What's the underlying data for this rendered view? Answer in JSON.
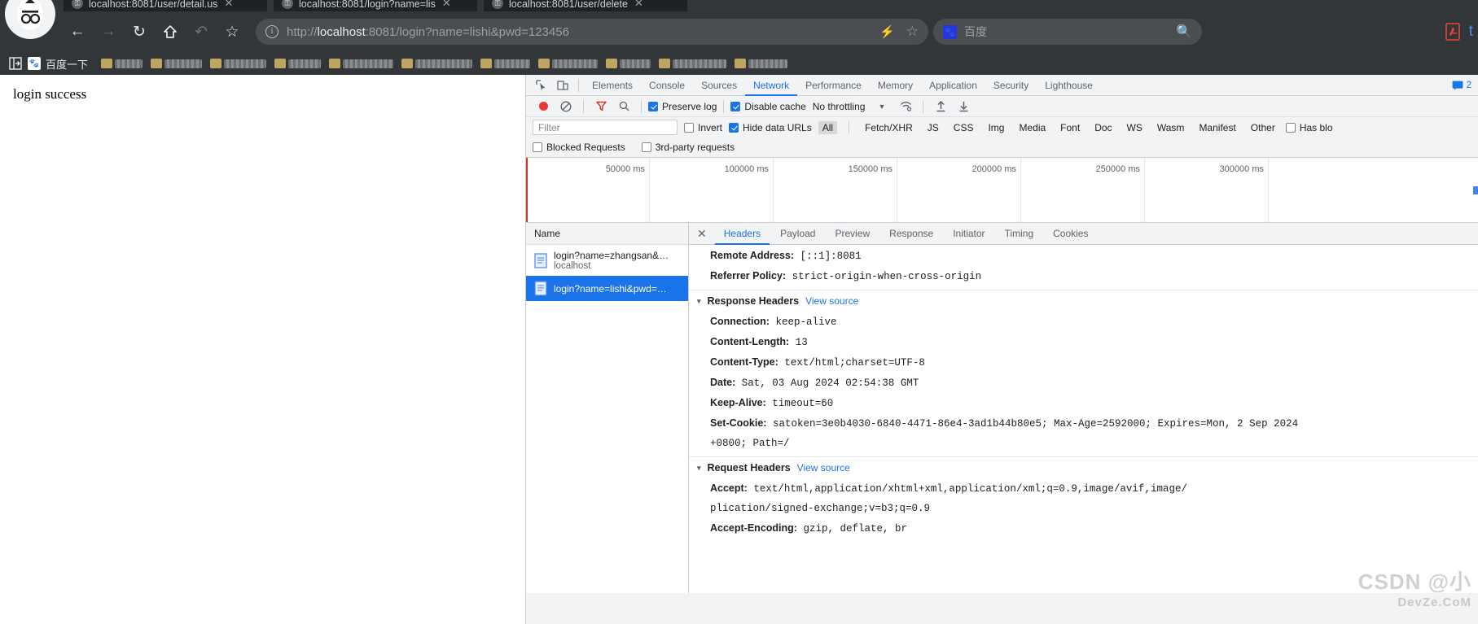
{
  "browser": {
    "tabs": [
      {
        "title": "localhost:8081/user/detail.us",
        "favicon": "shield-icon",
        "active": false
      },
      {
        "title": "localhost:8081/login?name=lis",
        "favicon": "shield-icon",
        "active": true
      },
      {
        "title": "localhost:8081/user/delete",
        "favicon": "shield-icon",
        "active": false
      }
    ],
    "nav": {
      "back": "←",
      "forward": "→",
      "reload": "↻",
      "home": "⌂",
      "undo": "↶",
      "bookmark_star": "☆"
    },
    "omnibox": {
      "security_icon": "info-icon",
      "url_scheme": "http://",
      "url_host": "localhost",
      "url_rest": ":8081/login?name=lishi&pwd=123456",
      "url_full": "http://localhost:8081/login?name=lishi&pwd=123456",
      "lightning_icon": "⚡",
      "star_icon": "☆"
    },
    "search": {
      "engine_icon": "baidu-paw-icon",
      "engine_label": "百度",
      "placeholder": "百度",
      "search_icon": "search-icon"
    },
    "toolbar_right": {
      "pdf_icon": "pdf-icon",
      "translate_icon": "t-icon"
    },
    "bookmarks": {
      "manager_icon": "bookmark-manager-icon",
      "first_label": "百度一下",
      "redacted_count": 11
    }
  },
  "page": {
    "body_text": "login success"
  },
  "devtools": {
    "inspect_icon": "inspect-cursor-icon",
    "device_icon": "device-toolbar-icon",
    "tabs": [
      {
        "label": "Elements",
        "active": false
      },
      {
        "label": "Console",
        "active": false
      },
      {
        "label": "Sources",
        "active": false
      },
      {
        "label": "Network",
        "active": true
      },
      {
        "label": "Performance",
        "active": false
      },
      {
        "label": "Memory",
        "active": false
      },
      {
        "label": "Application",
        "active": false
      },
      {
        "label": "Security",
        "active": false
      },
      {
        "label": "Lighthouse",
        "active": false
      }
    ],
    "message_badge": {
      "icon": "message-icon",
      "count": "2"
    },
    "network_toolbar": {
      "record_icon": "record-icon",
      "clear_icon": "clear-icon",
      "filter_icon": "filter-funnel-icon",
      "search_icon": "search-icon",
      "preserve_log": {
        "label": "Preserve log",
        "checked": true
      },
      "disable_cache": {
        "label": "Disable cache",
        "checked": true
      },
      "throttling": {
        "label": "No throttling",
        "caret": "▼"
      },
      "wifi_icon": "network-conditions-icon",
      "import_icon": "import-har-icon",
      "export_icon": "export-har-icon"
    },
    "filter_bar": {
      "filter_placeholder": "Filter",
      "invert": {
        "label": "Invert",
        "checked": false
      },
      "hide_data_urls": {
        "label": "Hide data URLs",
        "checked": true
      },
      "types": [
        {
          "label": "All",
          "selected": true
        },
        {
          "label": "Fetch/XHR",
          "selected": false
        },
        {
          "label": "JS",
          "selected": false
        },
        {
          "label": "CSS",
          "selected": false
        },
        {
          "label": "Img",
          "selected": false
        },
        {
          "label": "Media",
          "selected": false
        },
        {
          "label": "Font",
          "selected": false
        },
        {
          "label": "Doc",
          "selected": false
        },
        {
          "label": "WS",
          "selected": false
        },
        {
          "label": "Wasm",
          "selected": false
        },
        {
          "label": "Manifest",
          "selected": false
        },
        {
          "label": "Other",
          "selected": false
        }
      ],
      "has_blocked": {
        "label": "Has blo",
        "checked": false
      },
      "blocked_requests": {
        "label": "Blocked Requests",
        "checked": false
      },
      "third_party": {
        "label": "3rd-party requests",
        "checked": false
      }
    },
    "overview_ticks": [
      "50000 ms",
      "100000 ms",
      "150000 ms",
      "200000 ms",
      "250000 ms",
      "300000 ms"
    ],
    "request_list": {
      "column_header": "Name",
      "rows": [
        {
          "name": "login?name=zhangsan&…",
          "sub": "localhost",
          "selected": false,
          "icon": "document-icon"
        },
        {
          "name": "login?name=lishi&pwd=…",
          "sub": "",
          "selected": true,
          "icon": "document-icon"
        }
      ]
    },
    "detail": {
      "close_icon": "close-icon",
      "tabs": [
        {
          "label": "Headers",
          "active": true
        },
        {
          "label": "Payload",
          "active": false
        },
        {
          "label": "Preview",
          "active": false
        },
        {
          "label": "Response",
          "active": false
        },
        {
          "label": "Initiator",
          "active": false
        },
        {
          "label": "Timing",
          "active": false
        },
        {
          "label": "Cookies",
          "active": false
        }
      ],
      "general_rows": [
        {
          "key": "Remote Address:",
          "value": "[::1]:8081"
        },
        {
          "key": "Referrer Policy:",
          "value": "strict-origin-when-cross-origin"
        }
      ],
      "response_section": {
        "title": "Response Headers",
        "view_source": "View source",
        "caret": "▾"
      },
      "response_rows": [
        {
          "key": "Connection:",
          "value": "keep-alive"
        },
        {
          "key": "Content-Length:",
          "value": "13"
        },
        {
          "key": "Content-Type:",
          "value": "text/html;charset=UTF-8"
        },
        {
          "key": "Date:",
          "value": "Sat, 03 Aug 2024 02:54:38 GMT"
        },
        {
          "key": "Keep-Alive:",
          "value": "timeout=60"
        },
        {
          "key": "Set-Cookie:",
          "value": "satoken=3e0b4030-6840-4471-86e4-3ad1b44b80e5; Max-Age=2592000; Expires=Mon, 2 Sep 2024"
        },
        {
          "key": "",
          "value": "+0800; Path=/"
        }
      ],
      "request_section": {
        "title": "Request Headers",
        "view_source": "View source",
        "caret": "▾"
      },
      "request_rows": [
        {
          "key": "Accept:",
          "value": "text/html,application/xhtml+xml,application/xml;q=0.9,image/avif,image/"
        },
        {
          "key": "",
          "value": "plication/signed-exchange;v=b3;q=0.9"
        },
        {
          "key": "Accept-Encoding:",
          "value": "gzip, deflate, br"
        }
      ]
    }
  },
  "watermark": {
    "line1": "CSDN @小",
    "line2": "DevZe.CoM"
  }
}
